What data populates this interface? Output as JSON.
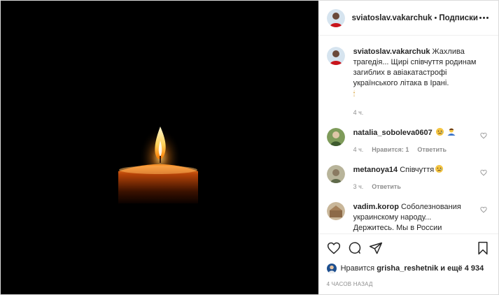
{
  "header": {
    "username": "sviatoslav.vakarchuk",
    "separator": "•",
    "follow_label": "Подписки"
  },
  "caption": {
    "username": "sviatoslav.vakarchuk",
    "text": "Жахлива трагедія... Щирі співчуття родинам загиблих в авіакатастрофі українського літака в Ірані.",
    "extra": "🕯",
    "time": "4 ч."
  },
  "comments": [
    {
      "username": "natalia_soboleva0607",
      "text": "",
      "emojis": [
        "sad-face",
        "person-bowing"
      ],
      "time": "4 ч.",
      "likes_label": "Нравится: 1",
      "reply_label": "Ответить"
    },
    {
      "username": "metanoya14",
      "text": "Співчуття",
      "emojis": [
        "sad-face"
      ],
      "time": "3 ч.",
      "reply_label": "Ответить"
    },
    {
      "username": "vadim.korop",
      "text": "Соболезнования украинскому народу... Держитесь. Мы в России разделяем ваше горе.",
      "emojis": [
        "sad-face"
      ]
    }
  ],
  "likes": {
    "prefix": "Нравится",
    "user": "grisha_reshetnik",
    "suffix": "и ещё 4 934"
  },
  "timestamp": "4 ЧАСОВ НАЗАД",
  "icons": {
    "like": "heart-icon",
    "comment": "comment-bubble-icon",
    "share": "paper-plane-icon",
    "save": "bookmark-icon"
  },
  "colors": {
    "text": "#262626",
    "muted": "#8e8e8e",
    "border": "#dbdbdb",
    "media_bg": "#000000"
  }
}
